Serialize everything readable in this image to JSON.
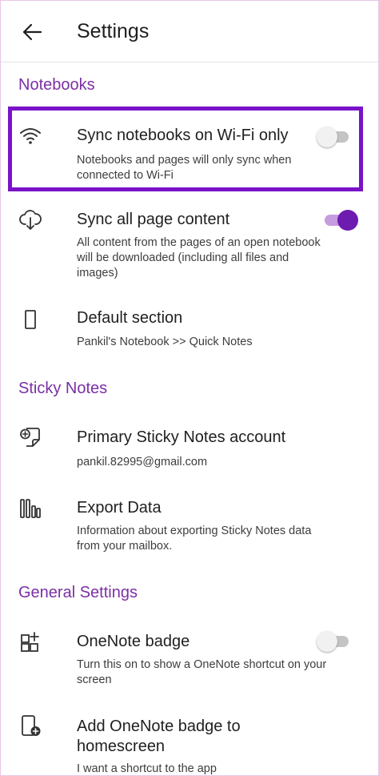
{
  "header": {
    "title": "Settings",
    "back_icon": "arrow-left-icon"
  },
  "colors": {
    "accent": "#7b2fa6",
    "highlight": "#7a12c8",
    "toggle_on": "#6e1bb0"
  },
  "sections": {
    "notebooks": "Notebooks",
    "sticky_notes": "Sticky Notes",
    "general": "General Settings"
  },
  "items": {
    "sync_wifi": {
      "title": "Sync notebooks on Wi-Fi only",
      "desc": "Notebooks and pages will only sync when connected to Wi-Fi",
      "icon": "wifi-icon",
      "toggle": false
    },
    "sync_all": {
      "title": "Sync all page content",
      "desc": "All content from the pages of an open notebook will be downloaded (including all files and images)",
      "icon": "cloud-download-icon",
      "toggle": true
    },
    "default_section": {
      "title": "Default section",
      "desc": "Pankil's Notebook >> Quick Notes",
      "icon": "section-icon"
    },
    "sticky_account": {
      "title": "Primary Sticky Notes account",
      "desc": "pankil.82995@gmail.com",
      "icon": "sticky-note-add-icon"
    },
    "export_data": {
      "title": "Export Data",
      "desc": "Information about exporting Sticky Notes data from your mailbox.",
      "icon": "library-icon"
    },
    "onenote_badge": {
      "title": "OneNote badge",
      "desc": "Turn this on to show a OneNote shortcut on your screen",
      "icon": "grid-add-icon",
      "toggle": false
    },
    "add_badge": {
      "title": "Add OneNote badge to homescreen",
      "desc": "I want a shortcut to the app",
      "icon": "phone-add-icon"
    }
  }
}
